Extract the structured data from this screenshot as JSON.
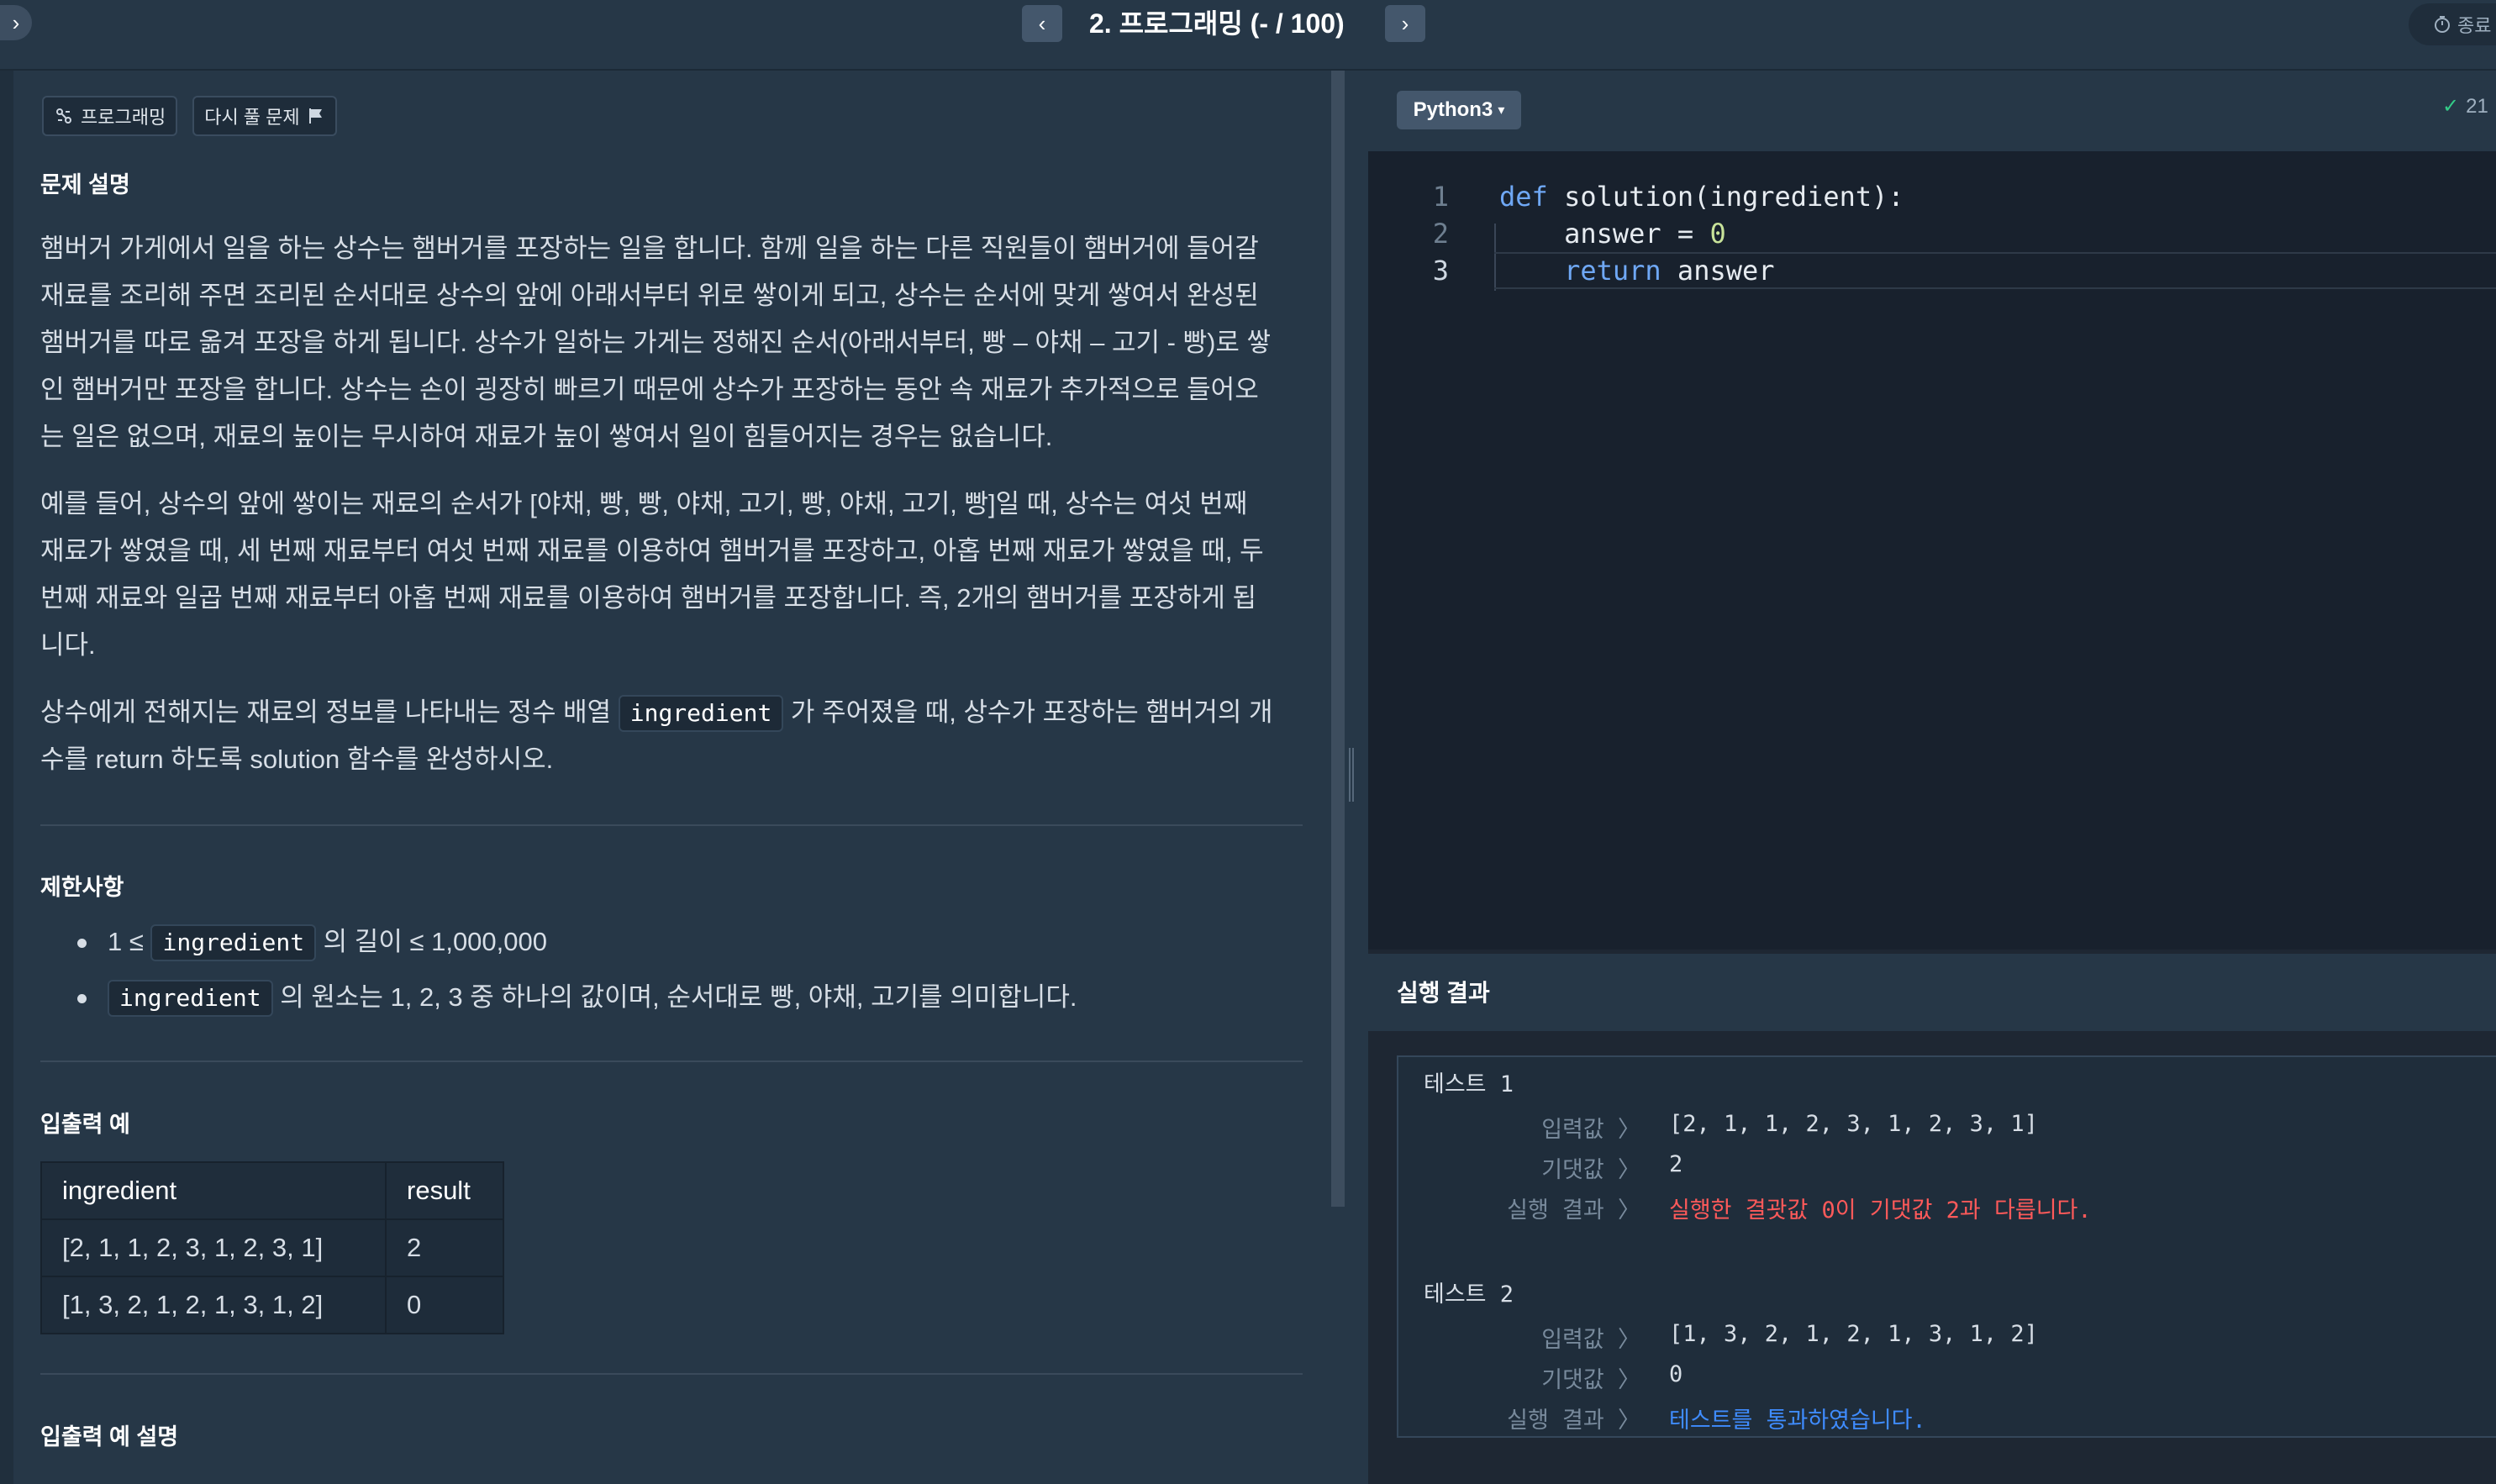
{
  "header": {
    "title": "2. 프로그래밍 (- / 100)",
    "prev_icon": "chevron-left-icon",
    "next_icon": "chevron-right-icon",
    "end_label": "종료"
  },
  "tags": {
    "category": "프로그래밍",
    "retry": "다시 풀 문제"
  },
  "problem": {
    "desc_title": "문제 설명",
    "desc_p1_lines": [
      "햄버거 가게에서 일을 하는 상수는 햄버거를 포장하는 일을 합니다. 함께 일을 하는 다른 직원들이 햄버거에 들어갈",
      "재료를 조리해 주면 조리된 순서대로 상수의 앞에 아래서부터 위로 쌓이게 되고, 상수는 순서에 맞게 쌓여서 완성된",
      "햄버거를 따로 옮겨 포장을 하게 됩니다. 상수가 일하는 가게는 정해진 순서(아래서부터, 빵 – 야채 – 고기 - 빵)로 쌓",
      "인 햄버거만 포장을 합니다. 상수는 손이 굉장히 빠르기 때문에 상수가 포장하는 동안 속 재료가 추가적으로 들어오",
      "는 일은 없으며, 재료의 높이는 무시하여 재료가 높이 쌓여서 일이 힘들어지는 경우는 없습니다."
    ],
    "desc_p2_lines": [
      "예를 들어, 상수의 앞에 쌓이는 재료의 순서가 [야채, 빵, 빵, 야채, 고기, 빵, 야채, 고기, 빵]일 때, 상수는 여섯 번째",
      "재료가 쌓였을 때, 세 번째 재료부터 여섯 번째 재료를 이용하여 햄버거를 포장하고, 아홉 번째 재료가 쌓였을 때, 두",
      "번째 재료와 일곱 번째 재료부터 아홉 번째 재료를 이용하여 햄버거를 포장합니다. 즉, 2개의 햄버거를 포장하게 됩",
      "니다."
    ],
    "desc_p3_a": "상수에게 전해지는 재료의 정보를 나타내는 정수 배열 ",
    "desc_p3_code": "ingredient",
    "desc_p3_b": " 가 주어졌을 때, 상수가 포장하는 햄버거의 개",
    "desc_p3_c": "수를 return 하도록 solution 함수를 완성하시오.",
    "constraints_title": "제한사항",
    "c1_a": "1 ≤ ",
    "c1_code": "ingredient",
    "c1_b": " 의 길이 ≤ 1,000,000",
    "c2_code": "ingredient",
    "c2_b": " 의 원소는 1, 2, 3 중 하나의 값이며, 순서대로 빵, 야채, 고기를 의미합니다.",
    "io_title": "입출력 예",
    "io_headers": [
      "ingredient",
      "result"
    ],
    "io_rows": [
      [
        "[2, 1, 1, 2, 3, 1, 2, 3, 1]",
        "2"
      ],
      [
        "[1, 3, 2, 1, 2, 1, 3, 1, 2]",
        "0"
      ]
    ],
    "io_desc_title": "입출력 예 설명"
  },
  "editor": {
    "language": "Python3",
    "saved_count": "21",
    "lines": [
      {
        "n": "1",
        "kw": "def",
        "rest": " solution(ingredient):"
      },
      {
        "n": "2",
        "pre": "    ",
        "id": "answer = ",
        "num": "0"
      },
      {
        "n": "3",
        "pre": "    ",
        "kw": "return",
        "rest": " answer"
      }
    ]
  },
  "results": {
    "title": "실행 결과",
    "label_input": "입력값 〉",
    "label_expected": "기댓값 〉",
    "label_result": "실행 결과 〉",
    "tests": [
      {
        "title": "테스트 1",
        "input": "[2, 1, 1, 2, 3, 1, 2, 3, 1]",
        "expected": "2",
        "result": "실행한 결괏값 0이 기댓값 2과 다릅니다."
      },
      {
        "title": "테스트 2",
        "input": "[1, 3, 2, 1, 2, 1, 3, 1, 2]",
        "expected": "0",
        "result": "테스트를 통과하였습니다."
      }
    ]
  },
  "colors": {
    "fail": "#ff5a5a",
    "pass": "#3f8cff",
    "keyword": "#6fa8f5",
    "number": "#c8e39a"
  }
}
